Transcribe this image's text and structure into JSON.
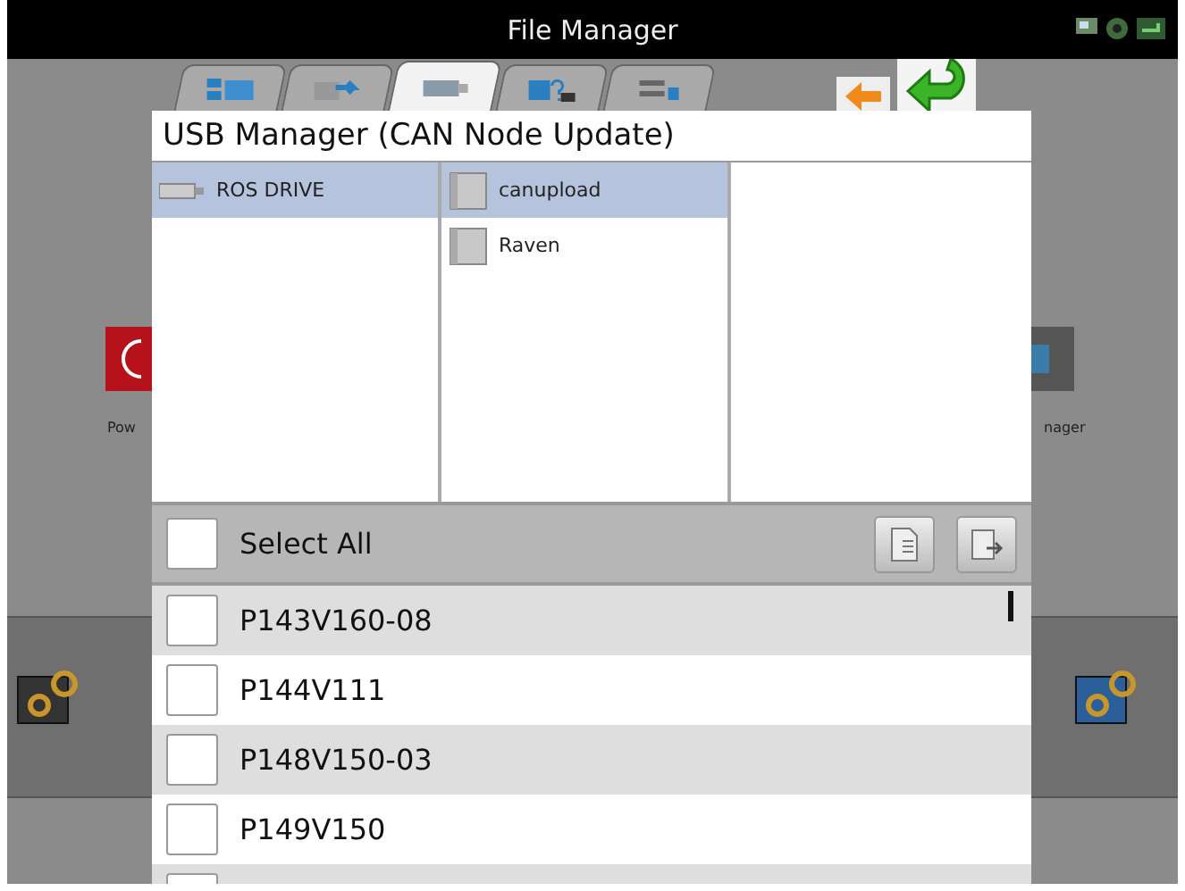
{
  "window": {
    "title": "File Manager"
  },
  "tabs": [
    {
      "kind": "windows",
      "selected": false
    },
    {
      "kind": "transfer",
      "selected": false
    },
    {
      "kind": "usb",
      "selected": true
    },
    {
      "kind": "help",
      "selected": false
    },
    {
      "kind": "list",
      "selected": false
    }
  ],
  "desktop": {
    "labels": [
      "Pow",
      "nager"
    ]
  },
  "dialog": {
    "title": "USB Manager (CAN Node Update)",
    "drives": [
      {
        "name": "ROS DRIVE",
        "selected": true
      }
    ],
    "folders": [
      {
        "name": "canupload",
        "selected": true
      },
      {
        "name": "Raven",
        "selected": false
      }
    ],
    "select_all": {
      "label": "Select All",
      "checked": false
    },
    "files": [
      {
        "name": "P143V160-08",
        "checked": false
      },
      {
        "name": "P144V111",
        "checked": false
      },
      {
        "name": "P148V150-03",
        "checked": false
      },
      {
        "name": "P149V150",
        "checked": false
      },
      {
        "checked": false
      }
    ]
  }
}
